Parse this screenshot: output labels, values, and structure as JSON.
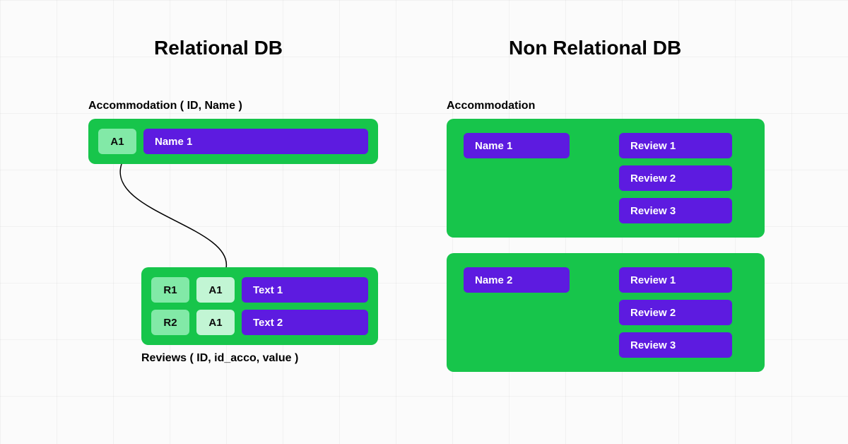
{
  "relational": {
    "title": "Relational DB",
    "accommodation": {
      "label": "Accommodation ( ID, Name )",
      "row": {
        "id": "A1",
        "name": "Name 1"
      }
    },
    "reviews": {
      "label": "Reviews ( ID, id_acco, value )",
      "rows": [
        {
          "id": "R1",
          "acco": "A1",
          "text": "Text 1"
        },
        {
          "id": "R2",
          "acco": "A1",
          "text": "Text 2"
        }
      ]
    }
  },
  "nonrelational": {
    "title": "Non Relational DB",
    "label": "Accommodation",
    "docs": [
      {
        "name": "Name 1",
        "reviews": [
          "Review 1",
          "Review 2",
          "Review 3"
        ]
      },
      {
        "name": "Name 2",
        "reviews": [
          "Review 1",
          "Review 2",
          "Review 3"
        ]
      }
    ]
  }
}
